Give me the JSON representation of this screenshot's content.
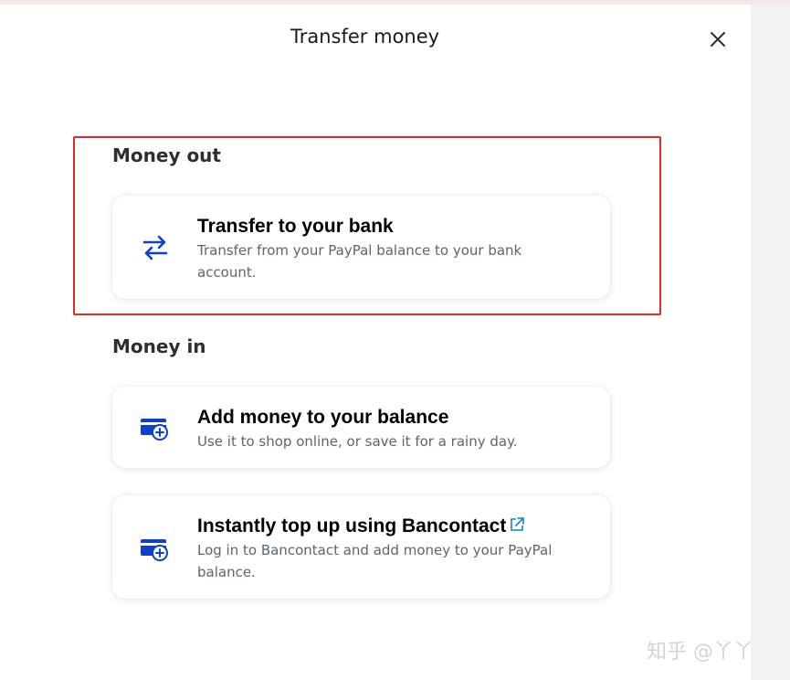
{
  "dialog": {
    "title": "Transfer money",
    "close_icon": "close-icon"
  },
  "sections": {
    "money_out": {
      "heading": "Money out",
      "items": [
        {
          "title": "Transfer to your bank",
          "description": "Transfer from your PayPal balance to your bank account.",
          "icon": "transfer-arrows-icon"
        }
      ]
    },
    "money_in": {
      "heading": "Money in",
      "items": [
        {
          "title": "Add money to your balance",
          "description": "Use it to shop online, or save it for a rainy day.",
          "icon": "wallet-add-icon"
        },
        {
          "title": "Instantly top up using Bancontact",
          "description": "Log in to Bancontact and add money to your PayPal balance.",
          "icon": "wallet-add-icon",
          "link_icon": "external-link-icon"
        }
      ]
    }
  },
  "watermark": "知乎 @丫丫",
  "colors": {
    "icon_blue": "#1040c8",
    "highlight_red": "#e02b27",
    "title_text": "#000000",
    "description_text": "#5b6670",
    "link_teal": "#0a86c6"
  }
}
